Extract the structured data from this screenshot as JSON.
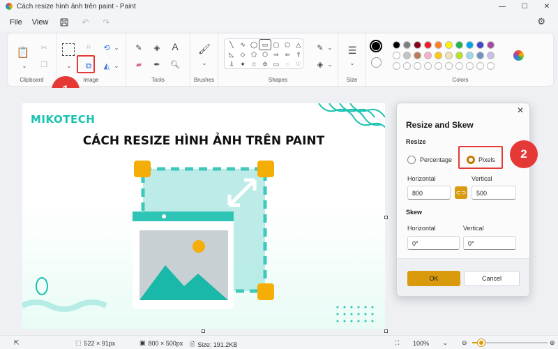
{
  "window": {
    "title": "Cách resize hình ảnh trên paint - Paint",
    "controls": [
      "—",
      "☐",
      "✕"
    ]
  },
  "menu": {
    "file": "File",
    "view": "View"
  },
  "ribbon": {
    "groups": {
      "clipboard": "Clipboard",
      "image": "Image",
      "tools": "Tools",
      "brushes": "Brushes",
      "shapes": "Shapes",
      "size": "Size",
      "colors": "Colors"
    },
    "palette_row1": [
      "#000000",
      "#7f7f7f",
      "#880015",
      "#ed1c24",
      "#ff7f27",
      "#fff200",
      "#22b14c",
      "#00a2e8",
      "#3f48cc",
      "#a349a4"
    ],
    "palette_row2": [
      "#ffffff",
      "#c3c3c3",
      "#b97a57",
      "#ffaec9",
      "#ffc90e",
      "#efe4b0",
      "#b5e61d",
      "#99d9ea",
      "#7092be",
      "#c8bfe7"
    ],
    "primary_color": "#000000",
    "secondary_color": "#ffffff"
  },
  "callouts": {
    "step1": "1",
    "step2": "2",
    "accent": "#e53935"
  },
  "artwork": {
    "brand": "MIKOTECH",
    "heading": "CÁCH RESIZE HÌNH ẢNH TRÊN PAINT"
  },
  "dialog": {
    "title": "Resize and Skew",
    "resize_label": "Resize",
    "option_percentage": "Percentage",
    "option_pixels": "Pixels",
    "selected_option": "Pixels",
    "horizontal_label": "Horizontal",
    "vertical_label": "Vertical",
    "resize_horizontal": "800",
    "resize_vertical": "500",
    "skew_label": "Skew",
    "skew_horizontal_label": "Horizontal",
    "skew_vertical_label": "Vertical",
    "skew_horizontal": "0°",
    "skew_vertical": "0°",
    "ok": "OK",
    "cancel": "Cancel",
    "accent": "#d99a0b"
  },
  "status": {
    "selection_size": "522 × 91px",
    "canvas_size": "800 × 500px",
    "file_size": "Size: 191.2KB",
    "zoom": "100%",
    "zoom_level": 0.12
  }
}
